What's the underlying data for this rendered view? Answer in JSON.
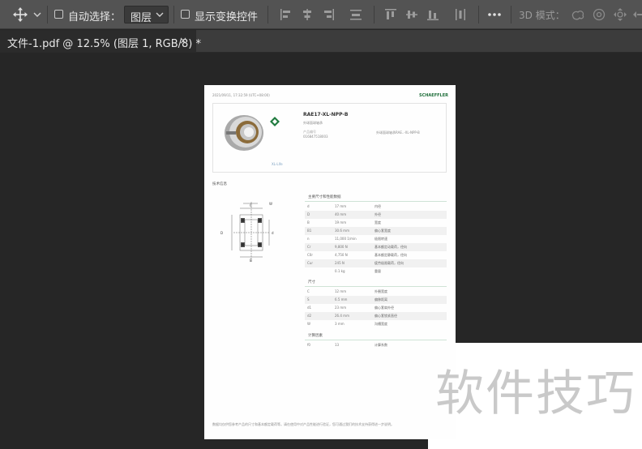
{
  "options_bar": {
    "auto_select_label": "自动选择：",
    "auto_select_target": "图层",
    "show_transform_label": "显示变换控件",
    "mode_3d_label": "3D 模式："
  },
  "tab": {
    "title": "文件-1.pdf @ 12.5% (图层 1, RGB/8) *",
    "close": "×"
  },
  "document": {
    "timestamp": "2021/09/11, 17:32:59 (UTC+08:00)",
    "brand": "SCHAEFFLER",
    "product_code": "RAE17-XL-NPP-B",
    "product_subtitle": "外球面球轴承",
    "article_label": "产品编号",
    "article_number": "016847518003",
    "spec_note": "外球面球轴承RAE..-XL-NPP-B",
    "image_caption": "XL-Life",
    "section_tech": "技术信息",
    "table_main_title": "主要尺寸和性能数据",
    "main_rows": [
      {
        "sym": "d",
        "val": "17 mm",
        "desc": "内径"
      },
      {
        "sym": "D",
        "val": "40 mm",
        "desc": "外径"
      },
      {
        "sym": "B",
        "val": "19 mm",
        "desc": "宽度"
      },
      {
        "sym": "B1",
        "val": "30.6 mm",
        "desc": "偏心套宽度"
      },
      {
        "sym": "n",
        "val": "11,000 1/min",
        "desc": "极限转速"
      },
      {
        "sym": "Cr",
        "val": "9,800 N",
        "desc": "基本额定动载荷，径向"
      },
      {
        "sym": "C0r",
        "val": "4,750 N",
        "desc": "基本额定静载荷，径向"
      },
      {
        "sym": "Cur",
        "val": "245 N",
        "desc": "疲劳极限载荷，径向"
      },
      {
        "sym": "",
        "val": "0.1 kg",
        "desc": "重量"
      }
    ],
    "table_dim_title": "尺寸",
    "dim_rows": [
      {
        "sym": "C",
        "val": "12 mm",
        "desc": "外圈宽度"
      },
      {
        "sym": "S",
        "val": "6.5 mm",
        "desc": "偏移距离"
      },
      {
        "sym": "d1",
        "val": "23 mm",
        "desc": "偏心套肩外径"
      },
      {
        "sym": "d2",
        "val": "26.4 mm",
        "desc": "偏心套锁紧直径"
      },
      {
        "sym": "W",
        "val": "3 mm",
        "desc": "沟槽宽度"
      }
    ],
    "table_calc_title": "计算因素",
    "calc_rows": [
      {
        "sym": "f0",
        "val": "13",
        "desc": "计算系数"
      }
    ],
    "footer_note": "数据均仅供您参考产品的尺寸和基本额定载荷等。请在使用中对产品性能进行验证，您可通过我们的技术支持获得进一步说明。"
  },
  "watermark": "软件技巧"
}
